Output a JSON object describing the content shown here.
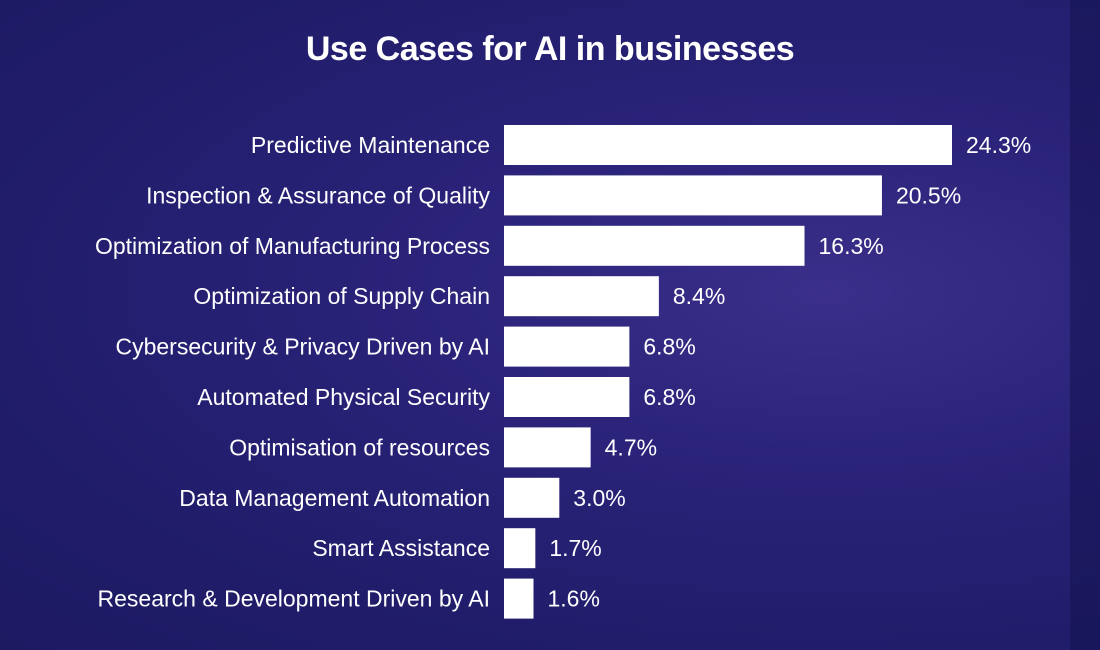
{
  "chart_data": {
    "type": "bar",
    "orientation": "horizontal",
    "title": "Use Cases for AI in businesses",
    "xlabel": "",
    "ylabel": "",
    "categories": [
      "Predictive Maintenance",
      "Inspection & Assurance of Quality",
      "Optimization of Manufacturing Process",
      "Optimization of Supply Chain",
      "Cybersecurity & Privacy Driven by AI",
      "Automated Physical Security",
      "Optimisation of resources",
      "Data Management Automation",
      "Smart Assistance",
      "Research & Development Driven by AI"
    ],
    "values": [
      24.3,
      20.5,
      16.3,
      8.4,
      6.8,
      6.8,
      4.7,
      3.0,
      1.7,
      1.6
    ],
    "value_labels": [
      "24.3%",
      "20.5%",
      "16.3%",
      "8.4%",
      "6.8%",
      "6.8%",
      "4.7%",
      "3.0%",
      "1.7%",
      "1.6%"
    ],
    "unit": "%",
    "xlim": [
      0,
      24.3
    ],
    "grid": false,
    "bar_color": "#ffffff",
    "background_color": "#231f6e"
  }
}
